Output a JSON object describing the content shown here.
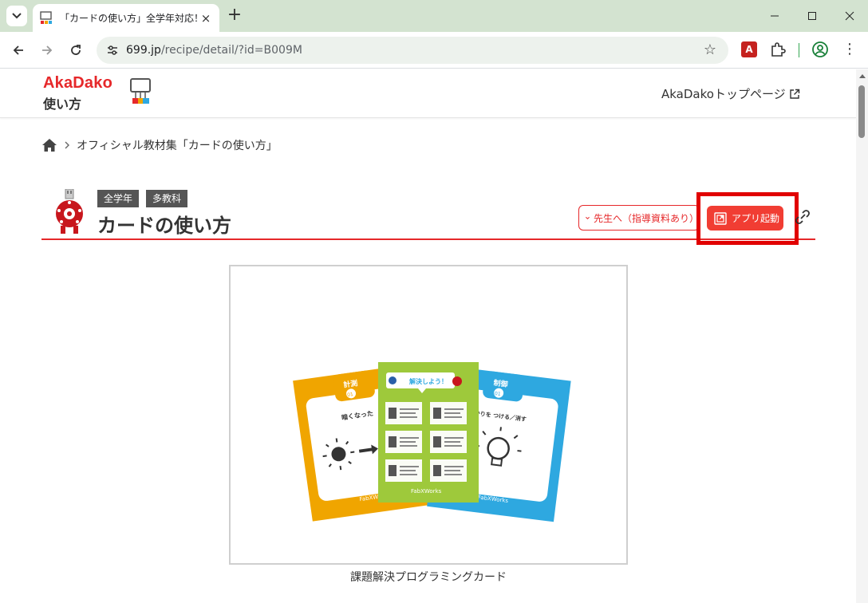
{
  "browser": {
    "tab_title": "「カードの使い方」全学年対応！多",
    "url_host": "699.jp",
    "url_path": "/recipe/detail/?id=B009M",
    "new_tab_label": "+",
    "tab_close_label": "×",
    "star_label": "☆",
    "menu_label": "⋮",
    "pdf_ext_label": "A"
  },
  "header": {
    "logo_main": "AkaDako",
    "logo_sub": "使い方",
    "top_link": "AkaDakoトップページ"
  },
  "breadcrumb": {
    "current": "オフィシャル教材集「カードの使い方」"
  },
  "recipe": {
    "tags": [
      "全学年",
      "多教科"
    ],
    "title": "カードの使い方",
    "teacher_button": "先生へ（指導資料あり）",
    "app_button": "アプリ起動",
    "caption": "課題解決プログラミングカード"
  },
  "cards": {
    "left_header": "計測",
    "left_number": "01",
    "left_text": "暗くなった",
    "right_header": "制御",
    "right_number": "01",
    "right_text": "明かりを つける／消す",
    "center_banner": "解決しよう！",
    "brand": "FabXWorks"
  },
  "colors": {
    "accent": "#e6282a",
    "app_button": "#f13d33",
    "highlight": "#e10000",
    "card_orange": "#f0a500",
    "card_blue": "#2ea8e0",
    "card_green": "#9ec93b"
  }
}
